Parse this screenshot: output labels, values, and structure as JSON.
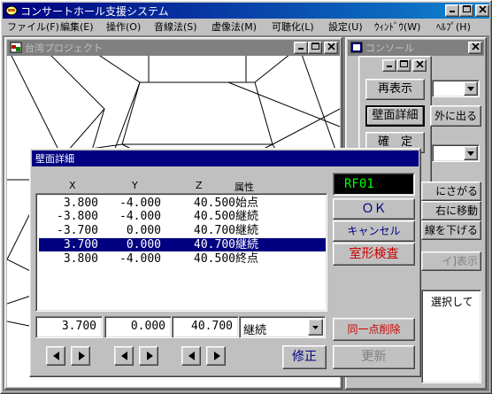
{
  "app": {
    "title": "コンサートホール支援システム",
    "menu": [
      "ファイル(F)",
      "編集(E)",
      "操作(O)",
      "音線法(S)",
      "虚像法(M)",
      "可聴化(L)",
      "設定(U)",
      "ｳｨﾝﾄﾞｳ(W)",
      "ﾍﾙﾌﾟ(H)"
    ]
  },
  "project_window": {
    "title": "台湾プロジェクト"
  },
  "console_window": {
    "title": "コンソール",
    "buttons": {
      "redisplay": "再表示",
      "wall_detail": "壁面詳細",
      "confirm": "確　定",
      "move_out": "外に出る",
      "lower_right": "にさがる",
      "move_right": "右に移動",
      "lower": "線を下げる",
      "show": "イ]表示"
    },
    "text_hint": "選択して"
  },
  "dialog": {
    "title": "壁面詳細",
    "id_value": "RF01",
    "columns": [
      "X",
      "Y",
      "Z",
      "属性"
    ],
    "rows": [
      {
        "x": "3.800",
        "y": "-4.000",
        "z": "40.500",
        "attr": "始点"
      },
      {
        "x": "-3.800",
        "y": "-4.000",
        "z": "40.500",
        "attr": "継続"
      },
      {
        "x": "-3.700",
        "y": "0.000",
        "z": "40.700",
        "attr": "継続"
      },
      {
        "x": "3.700",
        "y": "0.000",
        "z": "40.700",
        "attr": "継続"
      },
      {
        "x": "3.800",
        "y": "-4.000",
        "z": "40.500",
        "attr": "終点"
      }
    ],
    "selected_row": 3,
    "edit": {
      "x": "3.700",
      "y": "0.000",
      "z": "40.700",
      "attr": "継続"
    },
    "buttons": {
      "ok": "ＯＫ",
      "cancel": "キャンセル",
      "check": "室形検査",
      "delete_point": "同一点削除",
      "modify": "修正",
      "update": "更新"
    },
    "colors": {
      "id_text": "#00ff00",
      "check_text": "#cc0000",
      "cancel_text": "#000080",
      "ok_text": "#000080"
    }
  }
}
